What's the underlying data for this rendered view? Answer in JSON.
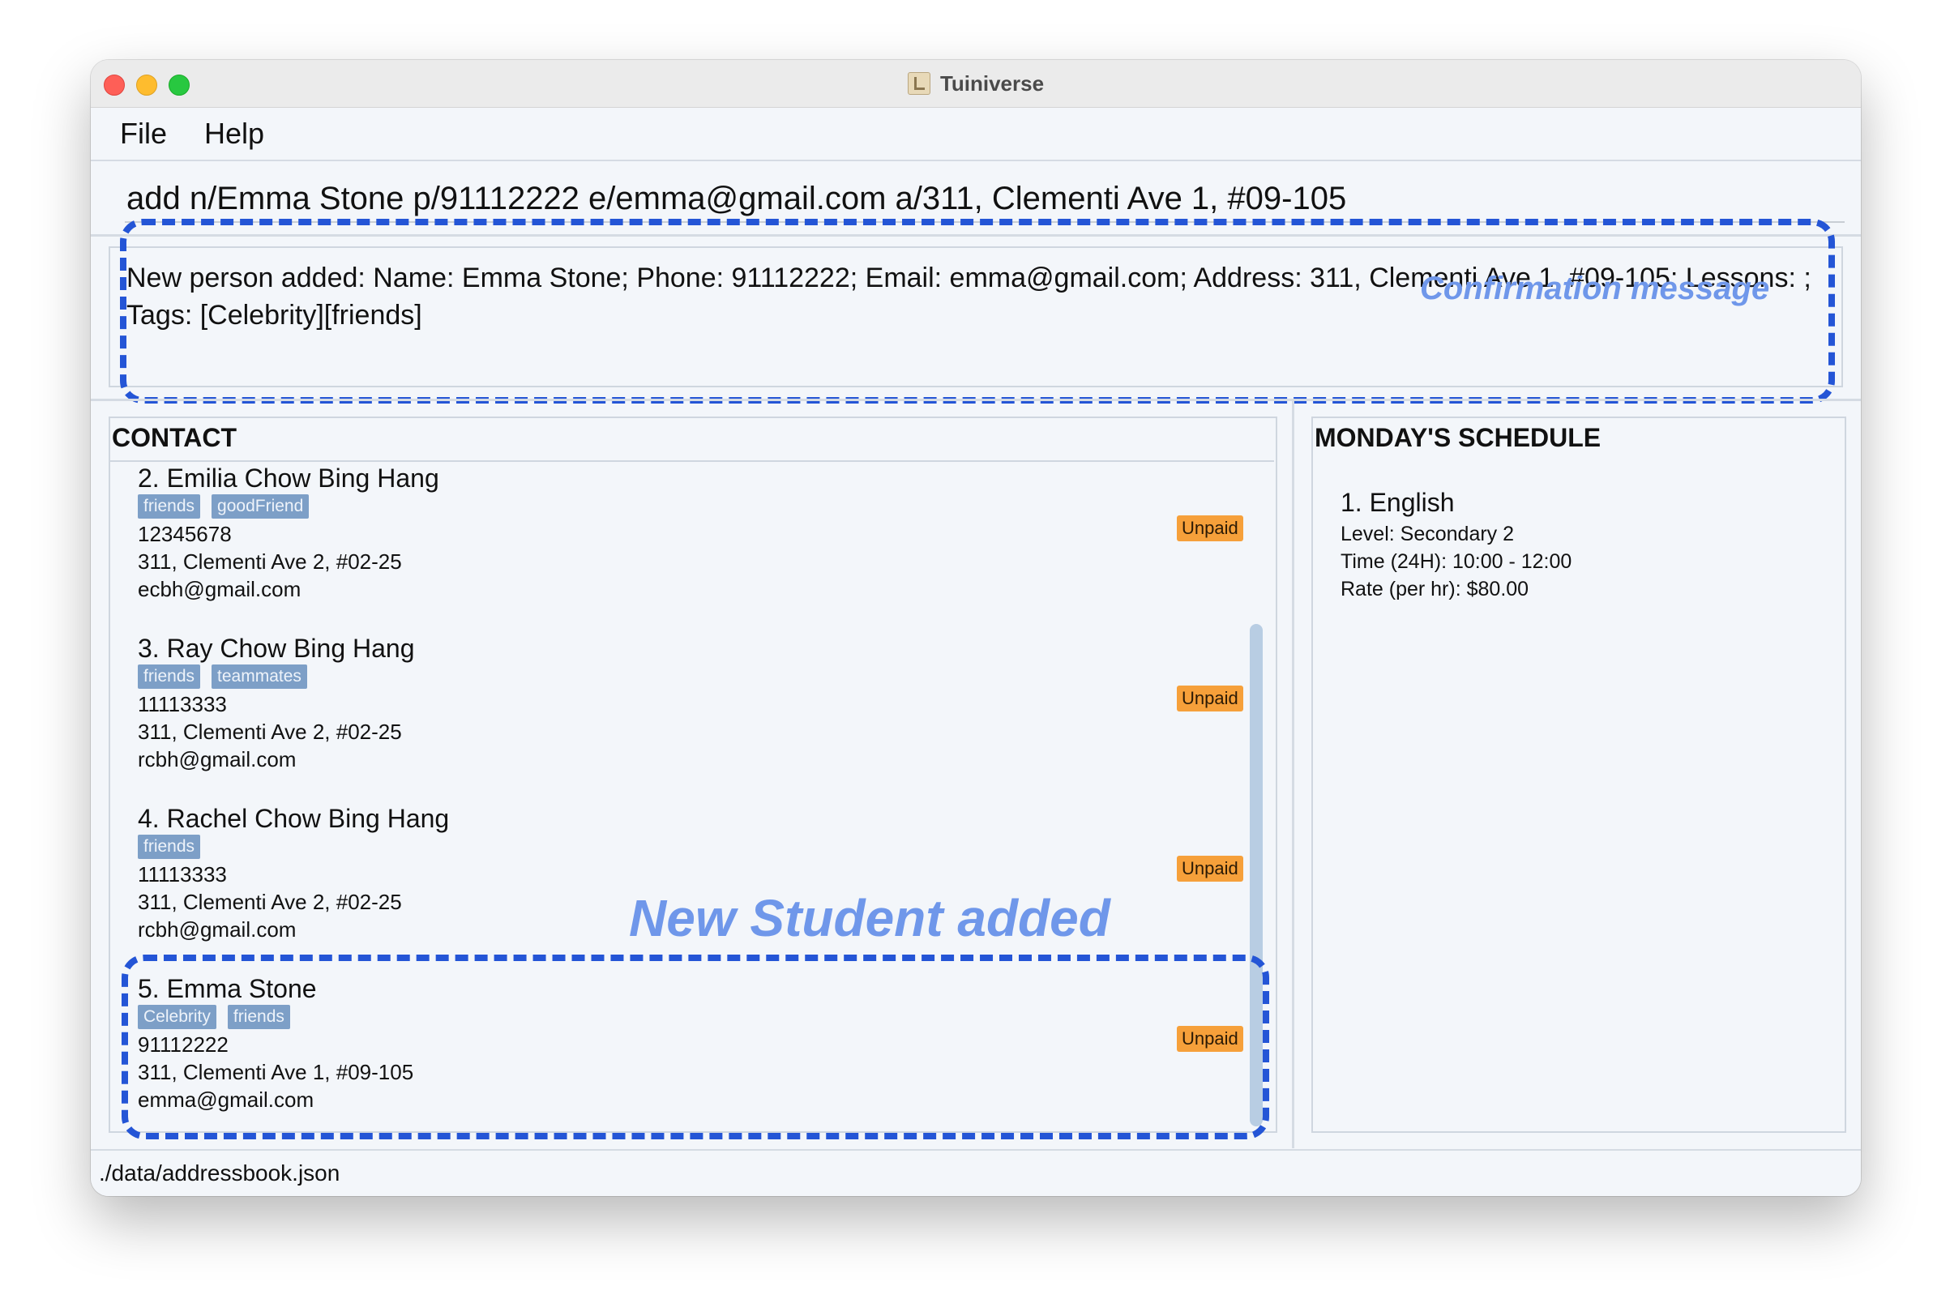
{
  "window": {
    "title": "Tuiniverse",
    "app_icon": "address-book-icon"
  },
  "menu": {
    "file": "File",
    "help": "Help"
  },
  "command": {
    "value": "add n/Emma Stone p/91112222 e/emma@gmail.com a/311, Clementi Ave 1, #09-105"
  },
  "result": {
    "message": "New person added: Name: Emma Stone; Phone: 91112222; Email: emma@gmail.com; Address: 311, Clementi Ave 1, #09-105; Lessons: ; Tags: [Celebrity][friends]"
  },
  "annotations": {
    "confirmation": "Confirmation message",
    "new_student": "New Student added"
  },
  "contacts": {
    "header": "CONTACT",
    "items": [
      {
        "name": "2. Emilia Chow Bing Hang",
        "tags": [
          "friends",
          "goodFriend"
        ],
        "phone": "12345678",
        "address": "311, Clementi Ave 2, #02-25",
        "email": "ecbh@gmail.com",
        "status": "Unpaid"
      },
      {
        "name": "3. Ray Chow Bing Hang",
        "tags": [
          "friends",
          "teammates"
        ],
        "phone": "11113333",
        "address": "311, Clementi Ave 2, #02-25",
        "email": "rcbh@gmail.com",
        "status": "Unpaid"
      },
      {
        "name": "4. Rachel Chow Bing Hang",
        "tags": [
          "friends"
        ],
        "phone": "11113333",
        "address": "311, Clementi Ave 2, #02-25",
        "email": "rcbh@gmail.com",
        "status": "Unpaid"
      },
      {
        "name": "5. Emma Stone",
        "tags": [
          "Celebrity",
          "friends"
        ],
        "phone": "91112222",
        "address": "311, Clementi Ave 1, #09-105",
        "email": "emma@gmail.com",
        "status": "Unpaid"
      }
    ]
  },
  "schedule": {
    "header": "MONDAY'S SCHEDULE",
    "lessons": [
      {
        "title": "1. English",
        "level": "Level: Secondary 2",
        "time": "Time (24H): 10:00 - 12:00",
        "rate": "Rate (per hr): $80.00"
      }
    ]
  },
  "status": {
    "path": "./data/addressbook.json"
  },
  "colors": {
    "accent_dash": "#2455d6",
    "annotation_text": "#6f97ea",
    "tag_bg": "#7d9fc7",
    "unpaid_badge": "#f6a03a"
  }
}
